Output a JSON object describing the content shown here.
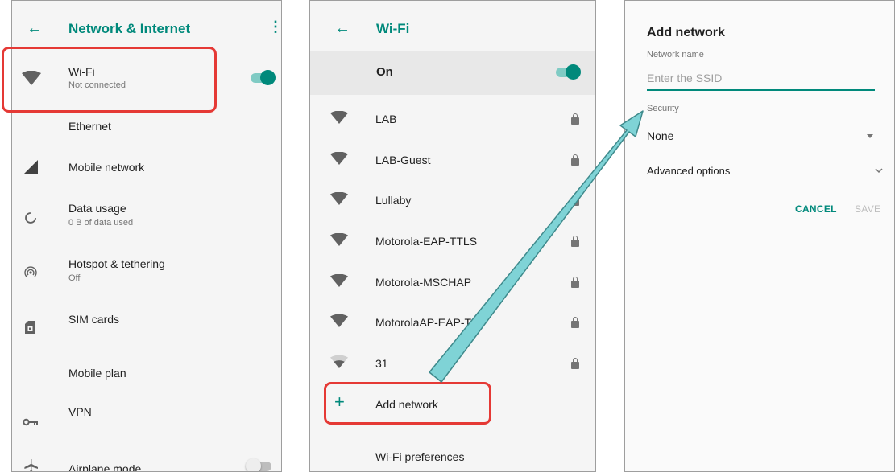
{
  "panel_network": {
    "title": "Network & Internet",
    "items": [
      {
        "label": "Wi-Fi",
        "sub": "Not connected"
      },
      {
        "label": "Ethernet"
      },
      {
        "label": "Mobile network"
      },
      {
        "label": "Data usage",
        "sub": "0 B of data used"
      },
      {
        "label": "Hotspot & tethering",
        "sub": "Off"
      },
      {
        "label": "SIM cards"
      },
      {
        "label": "Mobile plan"
      },
      {
        "label": "VPN"
      },
      {
        "label": "Airplane mode"
      }
    ],
    "wifi_toggle": "on",
    "airplane_toggle": "off"
  },
  "panel_wifi": {
    "title": "Wi-Fi",
    "master_label": "On",
    "master_toggle": "on",
    "networks": [
      {
        "name": "LAB",
        "secured": true
      },
      {
        "name": "LAB-Guest",
        "secured": true
      },
      {
        "name": "Lullaby",
        "secured": true
      },
      {
        "name": "Motorola-EAP-TTLS",
        "secured": true
      },
      {
        "name": "Motorola-MSCHAP",
        "secured": true
      },
      {
        "name": "MotorolaAP-EAP-TLS",
        "secured": true
      },
      {
        "name": "31",
        "secured": true
      }
    ],
    "add_label": "Add network",
    "preferences_label": "Wi-Fi preferences"
  },
  "panel_add": {
    "title": "Add network",
    "name_label": "Network name",
    "name_placeholder": "Enter the SSID",
    "security_label": "Security",
    "security_value": "None",
    "advanced_label": "Advanced options",
    "cancel_label": "CANCEL",
    "save_label": "SAVE"
  },
  "colors": {
    "accent": "#00897b",
    "highlight": "#e53935",
    "arrow": "#7fd3d6"
  },
  "icons": [
    "back-arrow-icon",
    "more-vert-icon",
    "wifi-icon",
    "signal-icon",
    "data-usage-icon",
    "hotspot-icon",
    "sim-card-icon",
    "vpn-key-icon",
    "airplane-icon",
    "lock-icon",
    "add-icon",
    "dropdown-icon",
    "chevron-down-icon"
  ]
}
